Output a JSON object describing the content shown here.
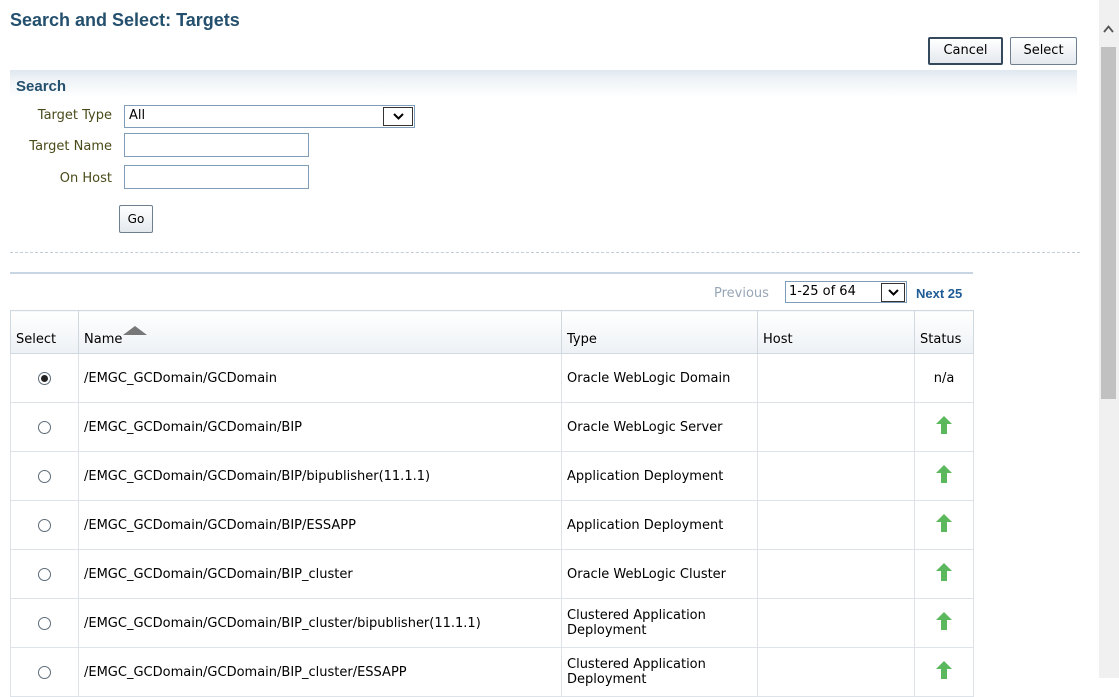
{
  "title": "Search and Select: Targets",
  "buttons": {
    "cancel": "Cancel",
    "select": "Select",
    "go": "Go"
  },
  "search": {
    "heading": "Search",
    "target_type_label": "Target Type",
    "target_type_value": "All",
    "target_name_label": "Target Name",
    "target_name_value": "",
    "on_host_label": "On Host",
    "on_host_value": ""
  },
  "pager": {
    "previous": "Previous",
    "range": "1-25 of 64",
    "next": "Next 25"
  },
  "table": {
    "columns": [
      "Select",
      "Name",
      "Type",
      "Host",
      "Status"
    ],
    "rows": [
      {
        "name": "/EMGC_GCDomain/GCDomain",
        "type": "Oracle WebLogic Domain",
        "status": "n/a",
        "selected": true
      },
      {
        "name": "/EMGC_GCDomain/GCDomain/BIP",
        "type": "Oracle WebLogic Server",
        "status": "up"
      },
      {
        "name": "/EMGC_GCDomain/GCDomain/BIP/bipublisher(11.1.1)",
        "type": "Application Deployment",
        "status": "up"
      },
      {
        "name": "/EMGC_GCDomain/GCDomain/BIP/ESSAPP",
        "type": "Application Deployment",
        "status": "up"
      },
      {
        "name": "/EMGC_GCDomain/GCDomain/BIP_cluster",
        "type": "Oracle WebLogic Cluster",
        "status": "up"
      },
      {
        "name": "/EMGC_GCDomain/GCDomain/BIP_cluster/bipublisher(11.1.1)",
        "type": "Clustered Application Deployment",
        "status": "up"
      },
      {
        "name": "/EMGC_GCDomain/GCDomain/BIP_cluster/ESSAPP",
        "type": "Clustered Application Deployment",
        "status": "up"
      }
    ]
  },
  "colors": {
    "title": "#24506e",
    "link": "#1f5b95",
    "status_up": "#5cb85c"
  }
}
